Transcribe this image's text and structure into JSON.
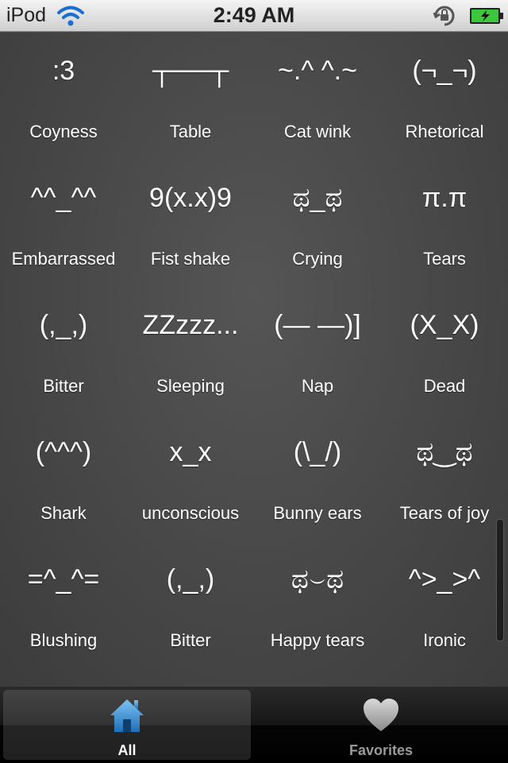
{
  "status_bar": {
    "carrier": "iPod",
    "time": "2:49 AM"
  },
  "grid": {
    "items": [
      {
        "emoticon": ":3",
        "label": "Coyness"
      },
      {
        "emoticon": "┬──┬",
        "label": "Table"
      },
      {
        "emoticon": "~.^ ^.~",
        "label": "Cat wink"
      },
      {
        "emoticon": "(¬_¬)",
        "label": "Rhetorical"
      },
      {
        "emoticon": "^^_^^",
        "label": "Embarrassed"
      },
      {
        "emoticon": "9(x.x)9",
        "label": "Fist shake"
      },
      {
        "emoticon": "ಥ_ಥ",
        "label": "Crying"
      },
      {
        "emoticon": "π.π",
        "label": "Tears"
      },
      {
        "emoticon": "(,_,)",
        "label": "Bitter"
      },
      {
        "emoticon": "ZZzzz...",
        "label": "Sleeping"
      },
      {
        "emoticon": "(— —)]",
        "label": "Nap"
      },
      {
        "emoticon": "(X_X)",
        "label": "Dead"
      },
      {
        "emoticon": "(^^^)",
        "label": "Shark"
      },
      {
        "emoticon": "x_x",
        "label": "unconscious"
      },
      {
        "emoticon": "(\\_/)",
        "label": "Bunny ears"
      },
      {
        "emoticon": "ಥ‿ಥ",
        "label": "Tears of joy"
      },
      {
        "emoticon": "=^_^=",
        "label": "Blushing"
      },
      {
        "emoticon": "(,_,)",
        "label": "Bitter"
      },
      {
        "emoticon": "ಥ⌣ಥ",
        "label": "Happy tears"
      },
      {
        "emoticon": "^>_>^",
        "label": "Ironic"
      }
    ]
  },
  "tab_bar": {
    "tabs": [
      {
        "label": "All",
        "icon": "home-icon",
        "selected": true
      },
      {
        "label": "Favorites",
        "icon": "heart-icon",
        "selected": false
      }
    ]
  },
  "colors": {
    "background": "#4a4a4a",
    "text": "#ffffff",
    "tab_selected_icon": "#3b8fd6",
    "tab_unselected": "#9a9a9a",
    "battery_fill": "#3cc83c"
  }
}
